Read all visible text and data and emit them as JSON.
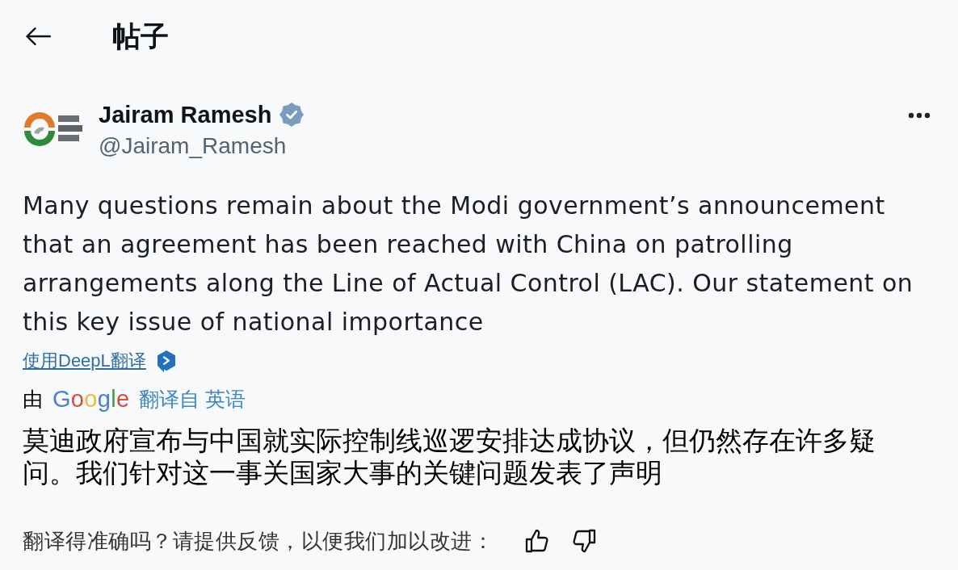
{
  "header": {
    "title": "帖子"
  },
  "post": {
    "author": {
      "name": "Jairam Ramesh",
      "verified": true,
      "handle": "@Jairam_Ramesh"
    },
    "text": "Many questions remain about the Modi government’s announcement that an agreement has been reached with China on patrolling arrangements along the Line of Actual Control (LAC). Our statement on this key issue of national importance",
    "translate_link": "使用DeepL翻译",
    "translation": {
      "prefix": "由",
      "provider": "Google",
      "source": "翻译自 英语",
      "text": "莫迪政府宣布与中国就实际控制线巡逻安排达成协议，但仍然存在许多疑问。我们针对这一事关国家大事的关键问题发表了声明"
    }
  },
  "feedback": {
    "prompt": "翻译得准确吗？请提供反馈，以便我们加以改进："
  }
}
